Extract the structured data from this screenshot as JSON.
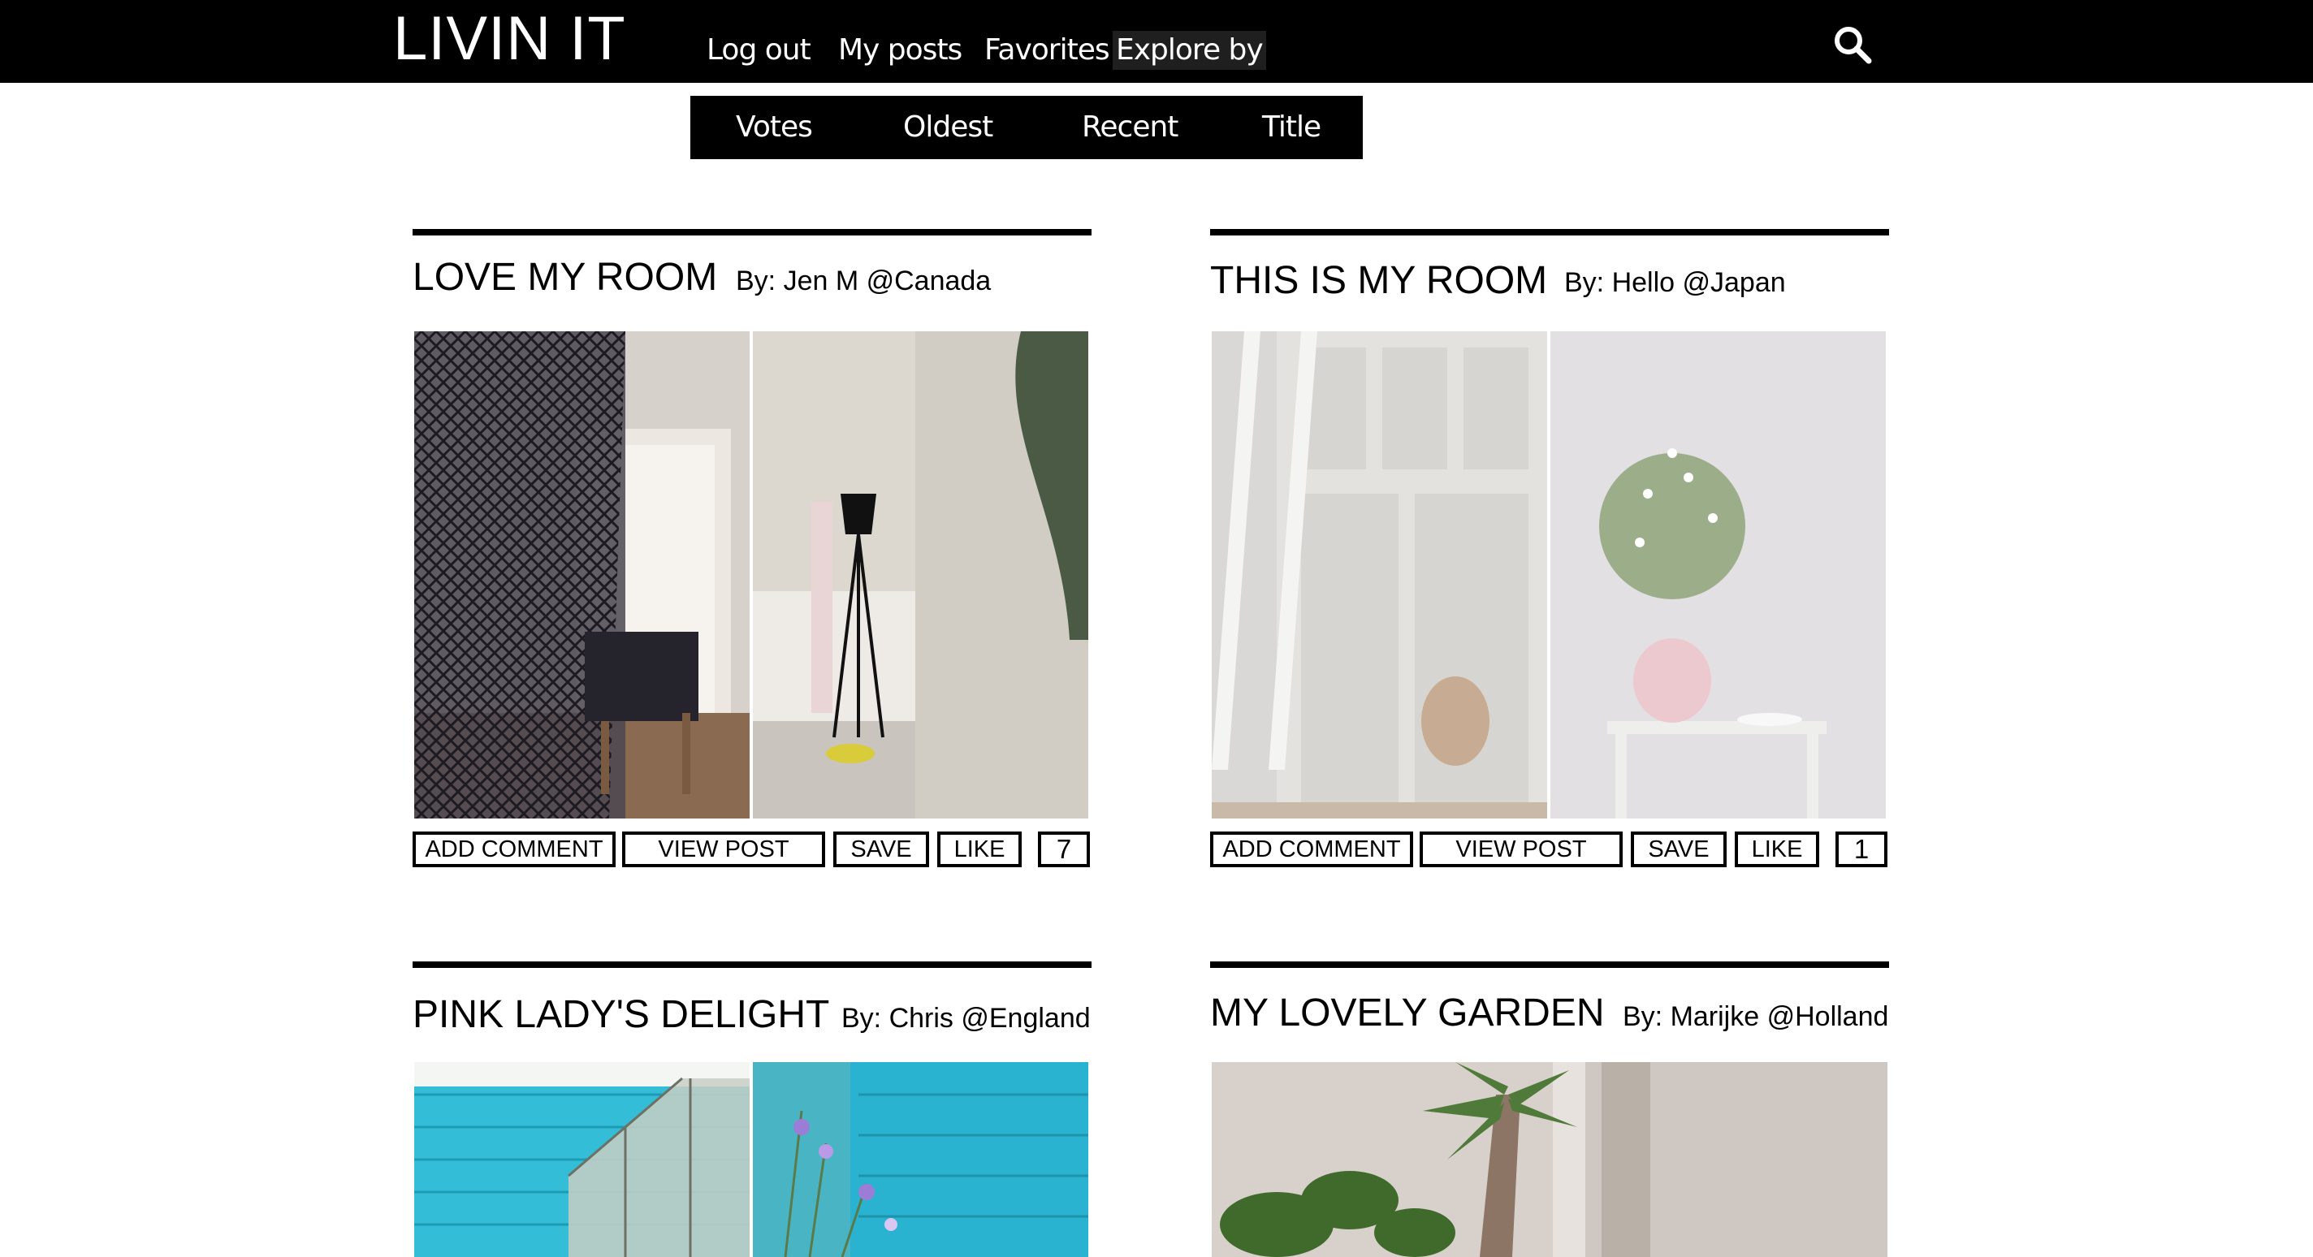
{
  "app": {
    "title": "LIVIN IT"
  },
  "nav": {
    "items": [
      {
        "label": "Log out"
      },
      {
        "label": "My posts"
      },
      {
        "label": "Favorites"
      },
      {
        "label": "Explore by"
      }
    ]
  },
  "sort": {
    "options": [
      {
        "label": "Votes"
      },
      {
        "label": "Oldest"
      },
      {
        "label": "Recent"
      },
      {
        "label": "Title"
      }
    ]
  },
  "actions": {
    "add_comment": "ADD COMMENT",
    "view_post": "VIEW POST",
    "save": "SAVE",
    "like": "LIKE"
  },
  "posts": [
    {
      "title": "LOVE MY ROOM",
      "author": "By: Jen M @Canada",
      "likes": "7"
    },
    {
      "title": "THIS IS MY ROOM",
      "author": "By: Hello @Japan",
      "likes": "1"
    },
    {
      "title": "PINK LADY'S DELIGHT",
      "author": "By: Chris @England"
    },
    {
      "title": "MY LOVELY GARDEN",
      "author": "By: Marijke @Holland"
    }
  ],
  "colors": {
    "bar": "#000000",
    "background": "#ffffff",
    "text": "#000000",
    "accent_turquoise": "#2fb8d3"
  },
  "icons": {
    "search": "search-icon"
  }
}
